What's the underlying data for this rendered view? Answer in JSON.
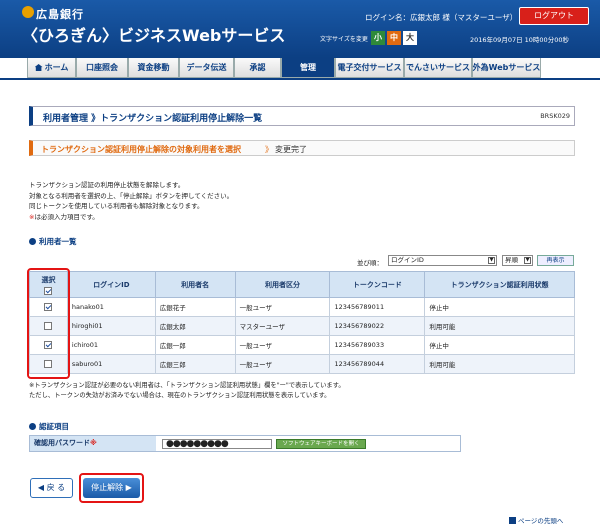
{
  "header": {
    "bank_name": "広島銀行",
    "service_title": "〈ひろぎん〉ビジネスWebサービス",
    "login_user": "ログイン名：広銀太郎 様（マスターユーザ）",
    "logout_label": "ログアウト",
    "font_size_label": "文字サイズを変更",
    "font_small": "小",
    "font_medium": "中",
    "font_large": "大",
    "datetime": "2016年09月07日 10時00分00秒"
  },
  "nav": {
    "tabs": [
      {
        "label": "ホーム"
      },
      {
        "label": "口座照会"
      },
      {
        "label": "資金移動"
      },
      {
        "label": "データ伝送"
      },
      {
        "label": "承認"
      },
      {
        "label": "管理"
      },
      {
        "label": "電子交付サービス"
      },
      {
        "label": "でんさいサービス"
      },
      {
        "label": "外為Webサービス"
      }
    ]
  },
  "page": {
    "title": "利用者管理 》トランザクション認証利用停止解除一覧",
    "screen_id": "BRSK029"
  },
  "steps": {
    "step1": "トランザクション認証利用停止解除の対象利用者を選択",
    "arrow": "》",
    "step2": "変更完了"
  },
  "description": {
    "line1": "トランザクション認証の利用停止状態を解除します。",
    "line2": "対象となる利用者を選択の上、「停止解除」ボタンを押してください。",
    "line3": "同じトークンを使用している利用者も解除対象となります。",
    "line4_mark": "※",
    "line4_text": "は必須入力項目です。"
  },
  "users_section": {
    "title": "利用者一覧",
    "sort_label": "並び順：",
    "sort_field": "ログインID",
    "sort_order": "昇順",
    "redisplay_label": "再表示",
    "columns": {
      "select": "選択",
      "login_id": "ログインID",
      "user_name": "利用者名",
      "user_type": "利用者区分",
      "token_code": "トークンコード",
      "status": "トランザクション認証利用状態"
    },
    "rows": [
      {
        "checked": true,
        "login_id": "hanako01",
        "user_name": "広銀花子",
        "user_type": "一般ユーザ",
        "token_code": "123456789011",
        "status": "停止中"
      },
      {
        "checked": false,
        "login_id": "hiroghi01",
        "user_name": "広銀太郎",
        "user_type": "マスターユーザ",
        "token_code": "123456789022",
        "status": "利用可能"
      },
      {
        "checked": true,
        "login_id": "ichiro01",
        "user_name": "広銀一郎",
        "user_type": "一般ユーザ",
        "token_code": "123456789033",
        "status": "停止中"
      },
      {
        "checked": false,
        "login_id": "saburo01",
        "user_name": "広銀三郎",
        "user_type": "一般ユーザ",
        "token_code": "123456789044",
        "status": "利用可能"
      }
    ],
    "note_line1": "※トランザクション認証が必要のない利用者は、「トランザクション認証利用状態」欄を\"ー\"で表示しています。",
    "note_line2": "ただし、トークンの失効がお済みでない場合は、現在のトランザクション認証利用状態を表示しています。"
  },
  "auth_section": {
    "title": "認証項目",
    "password_label": "確認用パスワード",
    "password_required_mark": "※",
    "password_value": "●●●●●●●●●",
    "software_keyboard_label": "ソフトウェアキーボードを開く"
  },
  "buttons": {
    "back": "◀ 戻 る",
    "release": "停止解除 ▶"
  },
  "footer": {
    "page_top": "ページの先頭へ"
  }
}
